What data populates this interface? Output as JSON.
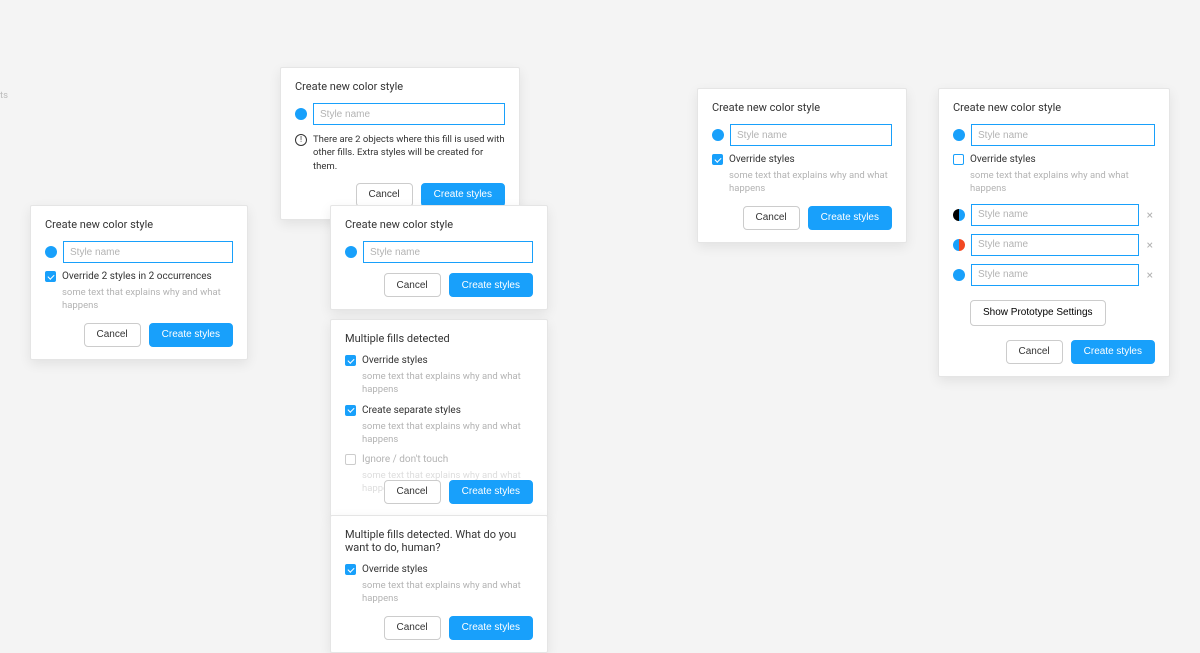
{
  "common": {
    "title_create": "Create new color style",
    "title_multiple": "Multiple fills detected",
    "title_multiple_human": "Multiple fills detected. What do you want to do, human?",
    "placeholder": "Style name",
    "cancel": "Cancel",
    "create": "Create styles",
    "help": "some text that explains why and what happens"
  },
  "d1": {
    "info": "There are 2 objects where this fill is used with other fills. Extra styles will be created for them."
  },
  "d2": {
    "chk_override": "Override 2 styles in 2 occurrences"
  },
  "d3": {},
  "d4": {
    "chk_override": "Override styles",
    "chk_separate": "Create separate styles",
    "chk_ignore": "Ignore / don't touch"
  },
  "d5": {
    "chk_override": "Override styles"
  },
  "d6": {
    "chk_override": "Override styles"
  },
  "d7": {
    "chk_override": "Override styles",
    "proto_btn": "Show Prototype Settings"
  },
  "chart_data": null
}
